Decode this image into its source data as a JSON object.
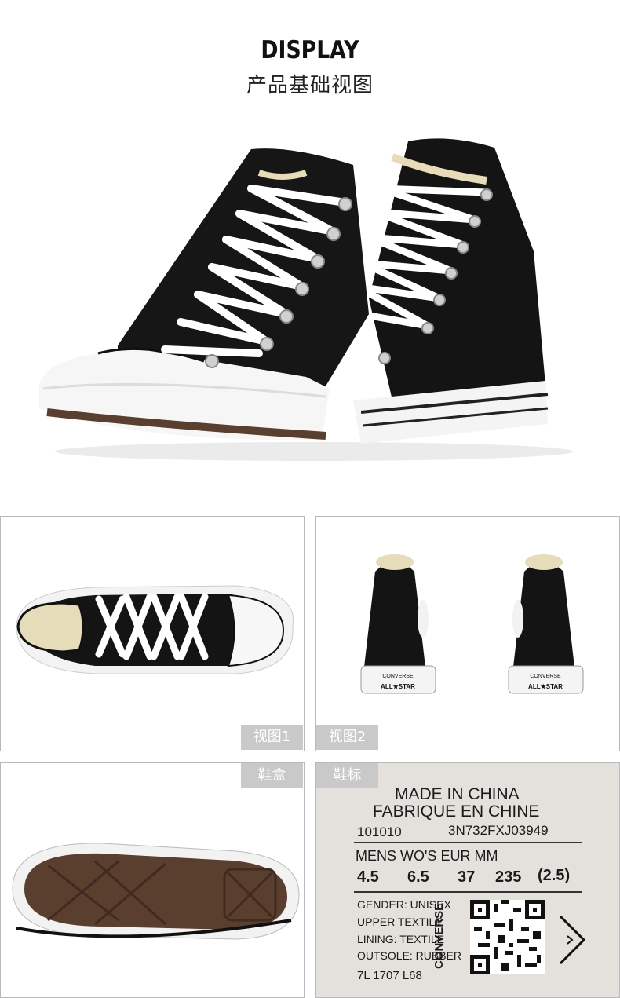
{
  "header": {
    "title_en": "DISPLAY",
    "title_cn": "产品基础视图"
  },
  "tags": {
    "view1": "视图1",
    "view2": "视图2",
    "box": "鞋盒",
    "label": "鞋标"
  },
  "shoe_branding": {
    "heel_brand": "CONVERSE",
    "heel_sub": "ALL★STAR"
  },
  "label": {
    "line1": "MADE IN CHINA",
    "line2": "FABRIQUE EN CHINE",
    "code_left": "101010",
    "code_right": "3N732FXJ03949",
    "size_header": "MENS WO'S EUR MM",
    "size_mens": "4.5",
    "size_wos": "6.5",
    "size_eur": "37",
    "size_mm": "235",
    "size_extra": "(2.5)",
    "gender": "GENDER: UNISEX",
    "upper": "UPPER TEXTILE",
    "lining": "LINING: TEXTILE",
    "outsole": "OUTSOLE: RUBBER",
    "footer": "7L  1707  L68",
    "brand_vertical": "CONVERSE"
  },
  "colors": {
    "canvas": "#111111",
    "rubber": "#ffffff",
    "sole_brown": "#5a3e2e",
    "tag_bg": "#c9c9c9",
    "label_bg": "#e4e0db"
  }
}
